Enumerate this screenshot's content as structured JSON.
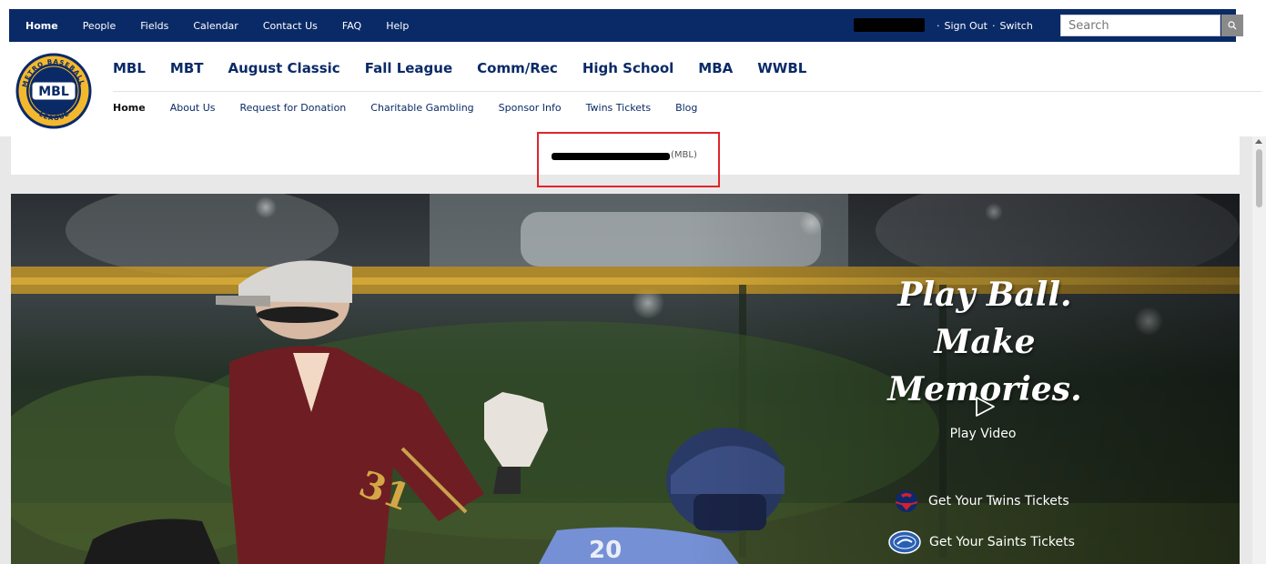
{
  "topnav": {
    "items": [
      "Home",
      "People",
      "Fields",
      "Calendar",
      "Contact Us",
      "FAQ",
      "Help"
    ],
    "active": "Home"
  },
  "user": {
    "sign_out": "Sign Out",
    "switch": "Switch",
    "separator": "·"
  },
  "search": {
    "placeholder": "Search"
  },
  "logo": {
    "text": "MBL",
    "ring_text": "METRO BASEBALL LEAGUE"
  },
  "mainnav": {
    "items": [
      "MBL",
      "MBT",
      "August Classic",
      "Fall League",
      "Comm/Rec",
      "High School",
      "MBA",
      "WWBL"
    ]
  },
  "subnav": {
    "items": [
      "Home",
      "About Us",
      "Request for Donation",
      "Charitable Gambling",
      "Sponsor Info",
      "Twins Tickets",
      "Blog"
    ],
    "active": "Home"
  },
  "context": {
    "suffix": "(MBL)"
  },
  "hero": {
    "line1": "Play Ball.",
    "line2": "Make Memories.",
    "play_video": "Play Video",
    "twins_tickets": "Get Your Twins Tickets",
    "saints_tickets": "Get Your Saints Tickets"
  },
  "colors": {
    "navy": "#0a2a67",
    "gold": "#f4b82e",
    "highlight_red": "#e0242b"
  }
}
